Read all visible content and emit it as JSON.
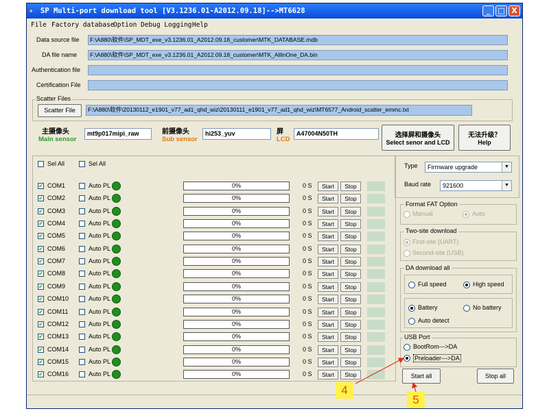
{
  "window": {
    "title": "SP Multi-port download tool [V3.1236.01-A2012.09.18]-->MT6628",
    "minimize": "_",
    "maximize": "□",
    "close": "X"
  },
  "menu": [
    "File",
    "Factory database",
    "Option",
    "Debug Logging",
    "Help"
  ],
  "files": {
    "data_source_label": "Data source file",
    "data_source_value": "F:\\A880\\软件\\SP_MDT_exe_v3.1236.01_A2012.09.18_customer\\MTK_DATABASE.mdb",
    "da_label": "DA file name",
    "da_value": "F:\\A880\\软件\\SP_MDT_exe_v3.1236.01_A2012.09.18_customer\\MTK_AllInOne_DA.bin",
    "auth_label": "Authentication file",
    "auth_value": "",
    "cert_label": "Certification File",
    "cert_value": "",
    "scatter_group": "Scatter Files",
    "scatter_button": "Scatter File",
    "scatter_value": "F:\\A880\\软件\\20130112_e1901_v77_ad1_qhd_wiz\\20130111_e1901_v77_ad1_qhd_wiz\\MT6577_Android_scatter_emmc.txt"
  },
  "sensors": {
    "main_cn": "主摄像头",
    "main_en": "Main sensor",
    "main_value": "mt9p017mipi_raw",
    "sub_cn": "前摄像头",
    "sub_en": "Sub sensor",
    "sub_value": "hi253_yuv",
    "lcd_cn": "屏",
    "lcd_en": "LCD",
    "lcd_value": "A47004N50TH",
    "select_cn": "选择屏和摄像头",
    "select_en": "Select senor and LCD",
    "help_cn": "无法升级？",
    "help_en": "Help"
  },
  "ports_header": {
    "sel_all_1": "Sel All",
    "sel_all_2": "Sel All"
  },
  "ports": [
    {
      "com": "COM1",
      "auto": "Auto PL",
      "progress": "0%",
      "time": "0 S",
      "start": "Start",
      "stop": "Stop"
    },
    {
      "com": "COM2",
      "auto": "Auto PL",
      "progress": "0%",
      "time": "0 S",
      "start": "Start",
      "stop": "Stop"
    },
    {
      "com": "COM3",
      "auto": "Auto PL",
      "progress": "0%",
      "time": "0 S",
      "start": "Start",
      "stop": "Stop"
    },
    {
      "com": "COM4",
      "auto": "Auto PL",
      "progress": "0%",
      "time": "0 S",
      "start": "Start",
      "stop": "Stop"
    },
    {
      "com": "COM5",
      "auto": "Auto PL",
      "progress": "0%",
      "time": "0 S",
      "start": "Start",
      "stop": "Stop"
    },
    {
      "com": "COM6",
      "auto": "Auto PL",
      "progress": "0%",
      "time": "0 S",
      "start": "Start",
      "stop": "Stop"
    },
    {
      "com": "COM7",
      "auto": "Auto PL",
      "progress": "0%",
      "time": "0 S",
      "start": "Start",
      "stop": "Stop"
    },
    {
      "com": "COM8",
      "auto": "Auto PL",
      "progress": "0%",
      "time": "0 S",
      "start": "Start",
      "stop": "Stop"
    },
    {
      "com": "COM9",
      "auto": "Auto PL",
      "progress": "0%",
      "time": "0 S",
      "start": "Start",
      "stop": "Stop"
    },
    {
      "com": "COM10",
      "auto": "Auto PL",
      "progress": "0%",
      "time": "0 S",
      "start": "Start",
      "stop": "Stop"
    },
    {
      "com": "COM11",
      "auto": "Auto PL",
      "progress": "0%",
      "time": "0 S",
      "start": "Start",
      "stop": "Stop"
    },
    {
      "com": "COM12",
      "auto": "Auto PL",
      "progress": "0%",
      "time": "0 S",
      "start": "Start",
      "stop": "Stop"
    },
    {
      "com": "COM13",
      "auto": "Auto PL",
      "progress": "0%",
      "time": "0 S",
      "start": "Start",
      "stop": "Stop"
    },
    {
      "com": "COM14",
      "auto": "Auto PL",
      "progress": "0%",
      "time": "0 S",
      "start": "Start",
      "stop": "Stop"
    },
    {
      "com": "COM15",
      "auto": "Auto PL",
      "progress": "0%",
      "time": "0 S",
      "start": "Start",
      "stop": "Stop"
    },
    {
      "com": "COM16",
      "auto": "Auto PL",
      "progress": "0%",
      "time": "0 S",
      "start": "Start",
      "stop": "Stop"
    }
  ],
  "settings": {
    "type_label": "Type",
    "type_value": "Firmware upgrade",
    "baud_label": "Baud rate",
    "baud_value": "921600",
    "format_group": "Format FAT Option",
    "format_manual": "Manual",
    "format_auto": "Auto",
    "twosite_group": "Two-site download",
    "twosite_first": "First-site (UART)",
    "twosite_second": "Second-site (USB)",
    "da_group": "DA download all",
    "da_full": "Full speed",
    "da_high": "High speed",
    "battery": "Battery",
    "no_battery": "No battery",
    "auto_detect": "Auto detect",
    "usb_group": "USB Port",
    "usb_bootrom": "BootRom--->DA",
    "usb_preloader": "Preloader--->DA",
    "start_all": "Start all",
    "stop_all": "Stop all"
  },
  "annotations": {
    "step4": "4",
    "step5": "5",
    "arrow_color": "#e0301e"
  }
}
